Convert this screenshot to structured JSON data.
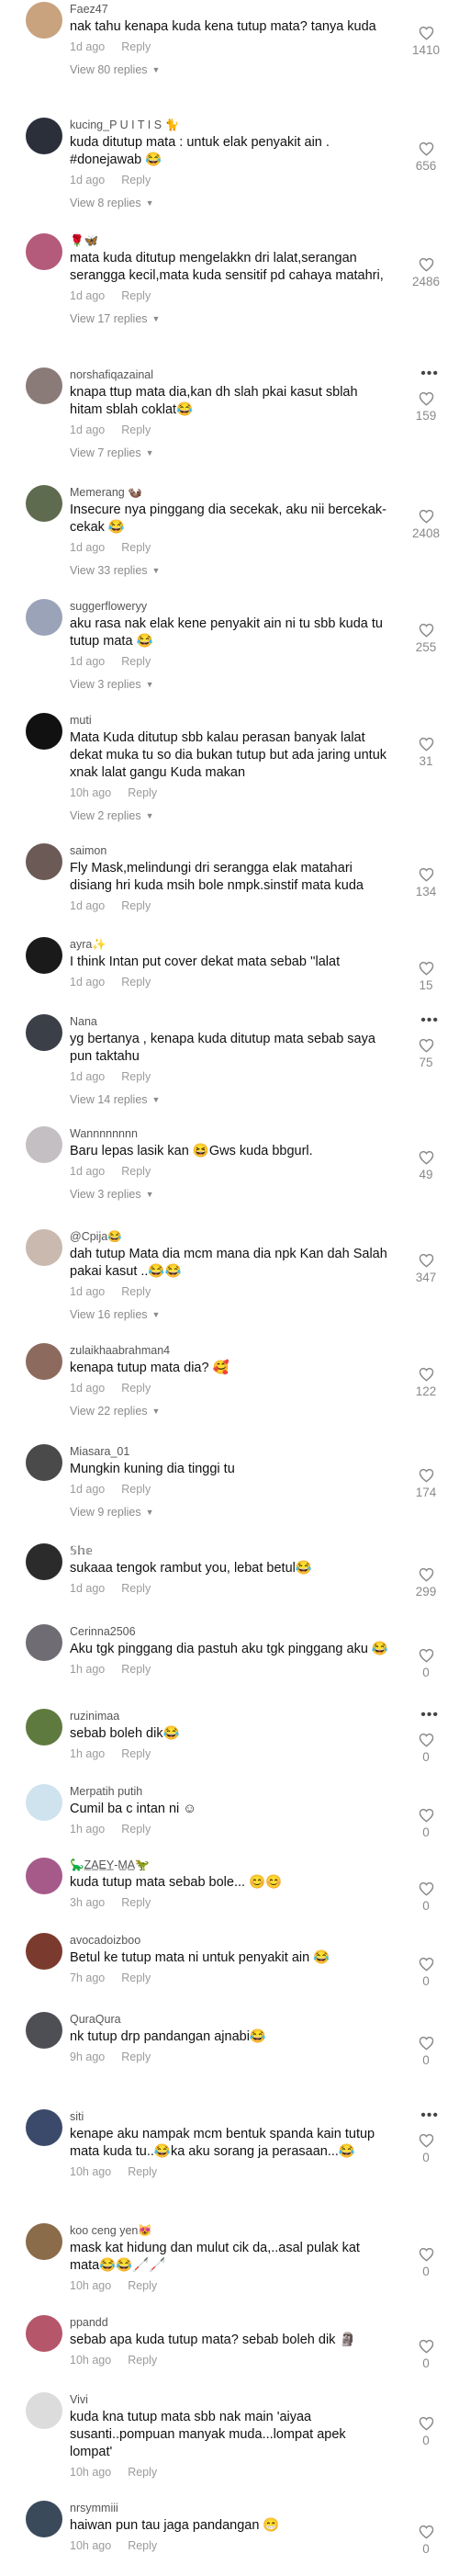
{
  "comments": [
    {
      "user": "Faez47",
      "text": "nak tahu kenapa kuda kena tutup mata? tanya kuda",
      "time": "1d ago",
      "reply": "Reply",
      "replies": "View 80 replies",
      "likes": "1410",
      "avatar": "#c9a27e"
    },
    {
      "user": "kucing_P U I T I S 🐈",
      "text": "kuda ditutup mata : untuk elak penyakit ain . #donejawab 😂",
      "time": "1d ago",
      "reply": "Reply",
      "replies": "View 8 replies",
      "likes": "656",
      "avatar": "#2a2f3a"
    },
    {
      "user": "🌹🦋",
      "text": "mata kuda ditutup mengelakkn dri lalat,serangan serangga kecil,mata kuda sensitif pd cahaya matahri,",
      "time": "1d ago",
      "reply": "Reply",
      "replies": "View 17 replies",
      "likes": "2486",
      "avatar": "#b45a7a"
    },
    {
      "user": "norshafiqazainal",
      "text": "knapa ttup mata dia,kan dh slah pkai kasut sblah hitam sblah coklat😂",
      "time": "1d ago",
      "reply": "Reply",
      "replies": "View 7 replies",
      "likes": "159",
      "avatar": "#8a7a78",
      "more": "•••"
    },
    {
      "user": "Memerang 🦦",
      "text": "Insecure nya pinggang dia secekak, aku nii bercekak-cekak 😂",
      "time": "1d ago",
      "reply": "Reply",
      "replies": "View 33 replies",
      "likes": "2408",
      "avatar": "#5e6b4e"
    },
    {
      "user": "suggerfloweryy",
      "text": "aku rasa nak elak kene penyakit ain ni tu sbb kuda tu tutup mata 😂",
      "time": "1d ago",
      "reply": "Reply",
      "replies": "View 3 replies",
      "likes": "255",
      "avatar": "#9aa3b8"
    },
    {
      "user": "muti",
      "text": "Mata Kuda ditutup sbb kalau perasan banyak lalat dekat muka tu so dia bukan tutup but ada jaring untuk xnak lalat gangu Kuda makan",
      "time": "10h ago",
      "reply": "Reply",
      "replies": "View 2 replies",
      "likes": "31",
      "avatar": "#111111"
    },
    {
      "user": "saimon",
      "text": "Fly Mask,melindungi dri serangga elak matahari disiang hri kuda msih bole nmpk.sinstif mata kuda",
      "time": "1d ago",
      "reply": "Reply",
      "replies": "",
      "likes": "134",
      "avatar": "#6b5a55"
    },
    {
      "user": "ayra✨",
      "text": "I think Intan put cover dekat mata sebab ''lalat",
      "time": "1d ago",
      "reply": "Reply",
      "replies": "",
      "likes": "15",
      "avatar": "#1a1a1a"
    },
    {
      "user": "Nana",
      "text": "yg bertanya , kenapa kuda ditutup mata sebab saya pun taktahu",
      "time": "1d ago",
      "reply": "Reply",
      "replies": "View 14 replies",
      "likes": "75",
      "avatar": "#3a3f48",
      "more": "•••"
    },
    {
      "user": "Wannnnnnnn",
      "text": "Baru lepas lasik kan 😆Gws kuda bbgurl.",
      "time": "1d ago",
      "reply": "Reply",
      "replies": "View 3 replies",
      "likes": "49",
      "avatar": "#c4bfc2"
    },
    {
      "user": "@Cpija😂",
      "text": "dah tutup Mata dia mcm mana dia npk Kan dah Salah pakai kasut ..😂😂",
      "time": "1d ago",
      "reply": "Reply",
      "replies": "View 16 replies",
      "likes": "347",
      "avatar": "#c9b9ae"
    },
    {
      "user": "zulaikhaabrahman4",
      "text": "kenapa tutup mata dia? 🥰",
      "time": "1d ago",
      "reply": "Reply",
      "replies": "View 22 replies",
      "likes": "122",
      "avatar": "#8c6a5e"
    },
    {
      "user": "Miasara_01",
      "text": "Mungkin kuning dia tinggi tu",
      "time": "1d ago",
      "reply": "Reply",
      "replies": "View 9 replies",
      "likes": "174",
      "avatar": "#4a4a4a"
    },
    {
      "user": "𝕊𝕙𝕖",
      "text": "sukaaa tengok rambut you, lebat betul😂",
      "time": "1d ago",
      "reply": "Reply",
      "replies": "",
      "likes": "299",
      "avatar": "#2b2b2b"
    },
    {
      "user": "Cerinna2506",
      "text": "Aku tgk pinggang dia pastuh aku tgk pinggang aku 😂",
      "time": "1h ago",
      "reply": "Reply",
      "replies": "",
      "likes": "0",
      "avatar": "#6f6d73"
    },
    {
      "user": "ruzinimaa",
      "text": "sebab boleh dik😂",
      "time": "1h ago",
      "reply": "Reply",
      "replies": "",
      "likes": "0",
      "avatar": "#5f7a3e",
      "more": "•••"
    },
    {
      "user": "Merpatih putih",
      "text": "Cumil ba c intan ni ☺",
      "time": "1h ago",
      "reply": "Reply",
      "replies": "",
      "likes": "0",
      "avatar": "#cfe3ee"
    },
    {
      "user": "🦕Z̲A̲E̲Y̲-M̲A̲🦖",
      "text": "kuda tutup mata sebab bole... 😊😊",
      "time": "3h ago",
      "reply": "Reply",
      "replies": "",
      "likes": "0",
      "avatar": "#a65a8a"
    },
    {
      "user": "avocadoizboo",
      "text": "Betul ke tutup mata ni untuk penyakit ain 😂",
      "time": "7h ago",
      "reply": "Reply",
      "replies": "",
      "likes": "0",
      "avatar": "#7a3b2e"
    },
    {
      "user": "QuraQura",
      "text": "nk tutup drp pandangan ajnabi😂",
      "time": "9h ago",
      "reply": "Reply",
      "replies": "",
      "likes": "0",
      "avatar": "#4d4f55"
    },
    {
      "user": "siti",
      "text": "kenape aku nampak mcm bentuk spanda kain tutup mata kuda tu..😂ka aku sorang ja perasaan...😂",
      "time": "10h ago",
      "reply": "Reply",
      "replies": "",
      "likes": "0",
      "avatar": "#3b4a6b",
      "more": "•••"
    },
    {
      "user": "koo ceng yen😻",
      "text": "mask kat hidung dan mulut cik da,..asal pulak kat mata😂😂🦯🦯",
      "time": "10h ago",
      "reply": "Reply",
      "replies": "",
      "likes": "0",
      "avatar": "#8a6b4a"
    },
    {
      "user": "ppandd",
      "text": "sebab apa kuda tutup mata? sebab boleh dik 🗿",
      "time": "10h ago",
      "reply": "Reply",
      "replies": "",
      "likes": "0",
      "avatar": "#b5566a"
    },
    {
      "user": "Vivi",
      "text": "kuda kna tutup mata sbb nak main 'aiyaa susanti..pompuan manyak muda...lompat apek lompat'",
      "time": "10h ago",
      "reply": "Reply",
      "replies": "",
      "likes": "0",
      "avatar": "#dcdcdc"
    },
    {
      "user": "nrsymmiii",
      "text": "haiwan pun tau jaga pandangan 😁",
      "time": "10h ago",
      "reply": "Reply",
      "replies": "",
      "likes": "0",
      "avatar": "#3a4a5a"
    }
  ],
  "colors": {
    "text": "#161823",
    "muted": "#9b9b9b",
    "heart": "#8a8a8a"
  },
  "icons": {
    "like": "heart-outline-icon",
    "more": "more-options-icon",
    "expand": "chevron-down-icon"
  }
}
